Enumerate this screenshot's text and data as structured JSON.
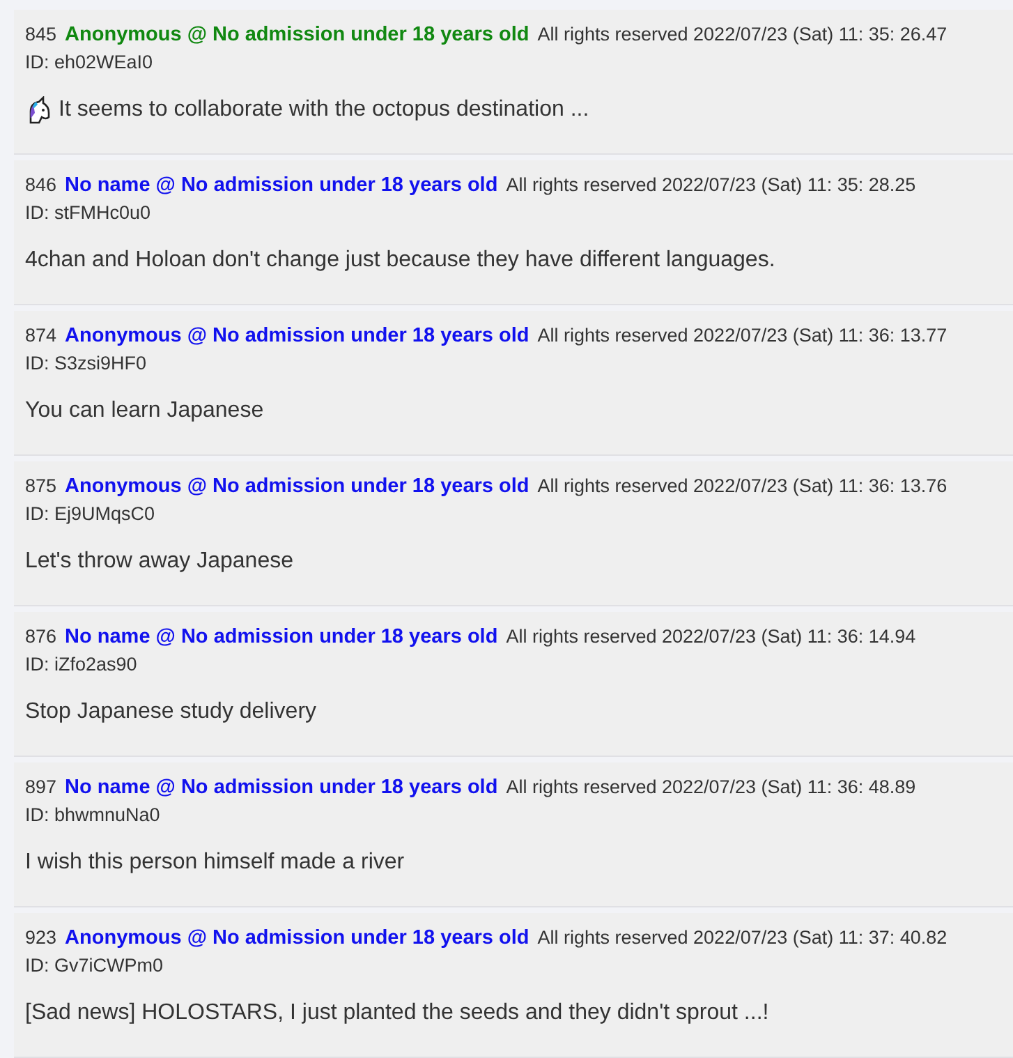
{
  "posts": [
    {
      "number": "845",
      "name": "Anonymous @ No admission under 18 years old",
      "color": "#118811",
      "date": "All rights reserved 2022/07/23 (Sat) 11: 35:  26.47",
      "id": "ID: eh02WEaI0",
      "has_icon": true,
      "body": "It seems to collaborate with the octopus destination ..."
    },
    {
      "number": "846",
      "name": "No name @ No admission under 18 years old",
      "color": "#1111ee",
      "date": "All rights reserved 2022/07/23 (Sat) 11: 35: 28.25",
      "id": "ID: stFMHc0u0",
      "body": "4chan and Holoan don't change just because they have different languages."
    },
    {
      "number": "874",
      "name": "Anonymous @ No admission under 18 years old",
      "color": "#1111ee",
      "date": "All rights reserved 2022/07/23 (Sat) 11: 36: 13.77",
      "id": "ID: S3zsi9HF0",
      "body": "You can learn Japanese"
    },
    {
      "number": "875",
      "name": "Anonymous @ No admission under 18 years old",
      "color": "#1111ee",
      "date": "All rights reserved 2022/07/23 (Sat) 11: 36: 13.76",
      "id": "ID: Ej9UMqsC0",
      "body": "Let's throw away Japanese"
    },
    {
      "number": "876",
      "name": "No name @ No admission under 18 years old",
      "color": "#1111ee",
      "date": "All rights reserved 2022/07/23 (Sat) 11: 36: 14.94",
      "id": "ID: iZfo2as90",
      "body": "Stop Japanese study delivery"
    },
    {
      "number": "897",
      "name": "No name @ No admission under 18 years old",
      "color": "#1111ee",
      "date": "All rights reserved 2022/07/23 (Sat) 11: 36: 48.89",
      "id": "ID: bhwmnuNa0",
      "body": "I wish this person himself made a river"
    },
    {
      "number": "923",
      "name": "Anonymous @ No admission under 18 years old",
      "color": "#1111ee",
      "date": "All rights reserved 2022/07/23 (Sat) 11: 37: 40.82",
      "id": "ID: Gv7iCWPm0",
      "body": "[Sad news] HOLOSTARS, I just planted the seeds and they didn't sprout ...!"
    }
  ]
}
